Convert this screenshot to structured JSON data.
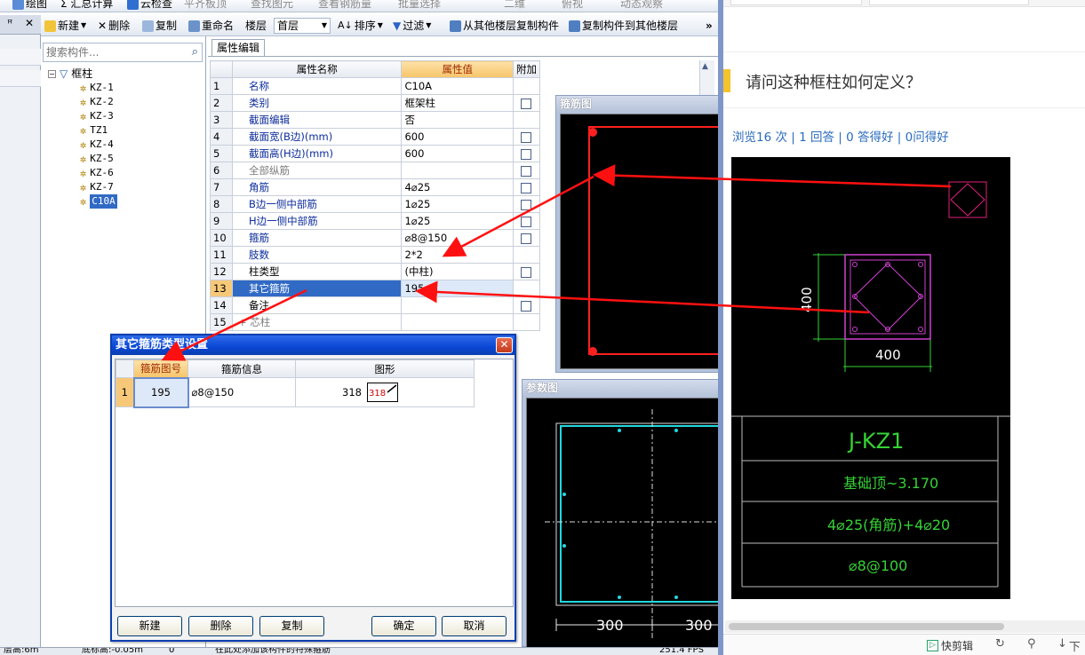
{
  "toolbar_top": {
    "items": [
      "绘图",
      "Σ 汇总计算",
      "云检查",
      "平齐板顶",
      "查找图元",
      "查看钢筋量",
      "批量选择",
      "二维",
      "俯视",
      "动态观察"
    ]
  },
  "toolbar": {
    "new": "新建",
    "delete": "删除",
    "copy": "复制",
    "rename": "重命名",
    "floor_label": "楼层",
    "floor_value": "首层",
    "sort": "排序",
    "filter": "过滤",
    "copy_from": "从其他楼层复制构件",
    "copy_to": "复制构件到其他楼层",
    "more": "»"
  },
  "search": {
    "placeholder": "搜索构件..."
  },
  "tree": {
    "root": "框柱",
    "items": [
      "KZ-1",
      "KZ-2",
      "KZ-3",
      "TZ1",
      "KZ-4",
      "KZ-5",
      "KZ-6",
      "KZ-7",
      "C10A"
    ]
  },
  "tab": {
    "label": "属性编辑"
  },
  "grid": {
    "headers": [
      "属性名称",
      "属性值",
      "附加"
    ],
    "rows": [
      {
        "n": "1",
        "name": "名称",
        "value": "C10A"
      },
      {
        "n": "2",
        "name": "类别",
        "value": "框架柱"
      },
      {
        "n": "3",
        "name": "截面编辑",
        "value": "否"
      },
      {
        "n": "4",
        "name": "截面宽(B边)(mm)",
        "value": "600"
      },
      {
        "n": "5",
        "name": "截面高(H边)(mm)",
        "value": "600"
      },
      {
        "n": "6",
        "name": "全部纵筋",
        "value": ""
      },
      {
        "n": "7",
        "name": "角筋",
        "value": "4⌀25"
      },
      {
        "n": "8",
        "name": "B边一侧中部筋",
        "value": "1⌀25"
      },
      {
        "n": "9",
        "name": "H边一侧中部筋",
        "value": "1⌀25"
      },
      {
        "n": "10",
        "name": "箍筋",
        "value": "⌀8@150"
      },
      {
        "n": "11",
        "name": "肢数",
        "value": "2*2"
      },
      {
        "n": "12",
        "name": "柱类型",
        "value": "(中柱)"
      },
      {
        "n": "13",
        "name": "其它箍筋",
        "value": "195"
      },
      {
        "n": "14",
        "name": "备注",
        "value": ""
      },
      {
        "n": "15",
        "name": "芯柱",
        "value": ""
      }
    ]
  },
  "panels": {
    "stirrup": "箍筋图",
    "param": "参数图"
  },
  "param_dims": {
    "left": "300",
    "right": "300"
  },
  "dialog": {
    "title": "其它箍筋类型设置",
    "headers": [
      "箍筋图号",
      "箍筋信息",
      "图形"
    ],
    "row": {
      "n": "1",
      "code": "195",
      "info": "⌀8@150",
      "shape_num": "318",
      "shape_label": "318"
    },
    "buttons": {
      "new": "新建",
      "delete": "删除",
      "copy": "复制",
      "ok": "确定",
      "cancel": "取消"
    }
  },
  "status": {
    "text1": "层高:6m",
    "text2": "底标高:-0.05m",
    "text3": "0",
    "text4": "在此处添加该构件的特殊箍筋",
    "text5": "251.4 FPS"
  },
  "web": {
    "question": "请问这种框柱如何定义？",
    "meta": "浏览16 次 | 1 回答 | 0 答得好 | 0问得好",
    "cad": {
      "dim_v": "400",
      "dim_h": "400",
      "name": "J-KZ1",
      "elev": "基础顶~3.170",
      "rebar": "4⌀25(角筋)+4⌀20",
      "stirrup": "⌀8@100"
    },
    "bottom": {
      "snip": "快剪辑",
      "next": "下"
    }
  }
}
